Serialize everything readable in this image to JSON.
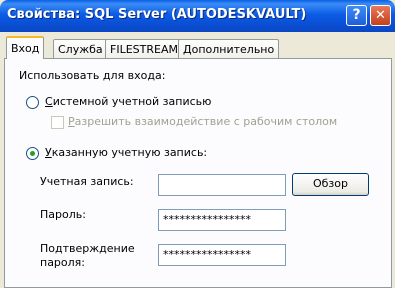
{
  "window": {
    "title": "Свойства: SQL Server (AUTODESKVAULT)",
    "help_button": "?",
    "close_button": "✕"
  },
  "tabs": [
    {
      "label": "Вход",
      "active": true
    },
    {
      "label": "Служба",
      "active": false
    },
    {
      "label": "FILESTREAM",
      "active": false
    },
    {
      "label": "Дополнительно",
      "active": false
    }
  ],
  "logon": {
    "group_label": "Использовать для входа:",
    "system_account_label_accel": "С",
    "system_account_label_rest": "истемной учетной записью",
    "allow_desktop_label_accel": "Р",
    "allow_desktop_label_rest": "азрешить взаимодействие с рабочим столом",
    "this_account_label_accel": "У",
    "this_account_label_rest": "казанную учетную запись:",
    "account_label": "Учетная запись:",
    "account_value": "",
    "browse_button": "Обзор",
    "password_label": "Пароль:",
    "password_value": "****************",
    "confirm_label_line1": "Подтверждение",
    "confirm_label_line2": "пароля:",
    "confirm_value": "****************"
  },
  "colors": {
    "titlebar": "#0a5fe6",
    "active_tab_accent": "#f8b82c",
    "radio_dot": "#21a121"
  }
}
